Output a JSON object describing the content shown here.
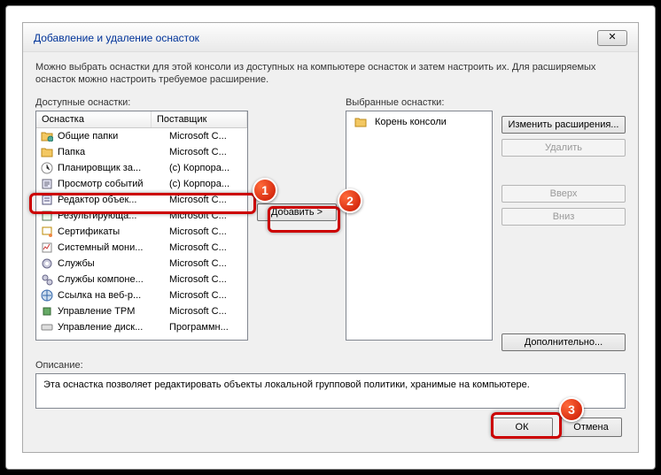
{
  "window": {
    "title": "Добавление и удаление оснасток",
    "close_glyph": "✕"
  },
  "intro": "Можно выбрать оснастки для этой консоли из доступных на компьютере оснасток и затем настроить их. Для расширяемых оснасток можно настроить требуемое расширение.",
  "available": {
    "label": "Доступные оснастки:",
    "col1": "Оснастка",
    "col2": "Поставщик",
    "items": [
      {
        "icon": "folder-share",
        "name": "Общие папки",
        "vendor": "Microsoft C..."
      },
      {
        "icon": "folder",
        "name": "Папка",
        "vendor": "Microsoft C..."
      },
      {
        "icon": "clock",
        "name": "Планировщик за...",
        "vendor": "(c) Корпора..."
      },
      {
        "icon": "event-log",
        "name": "Просмотр событий",
        "vendor": "(c) Корпора..."
      },
      {
        "icon": "gpo-editor",
        "name": "Редактор объек...",
        "vendor": "Microsoft C...",
        "selected": true
      },
      {
        "icon": "policy-result",
        "name": "Результирующа...",
        "vendor": "Microsoft C..."
      },
      {
        "icon": "certificate",
        "name": "Сертификаты",
        "vendor": "Microsoft C..."
      },
      {
        "icon": "perfmon",
        "name": "Системный мони...",
        "vendor": "Microsoft C..."
      },
      {
        "icon": "services",
        "name": "Службы",
        "vendor": "Microsoft C..."
      },
      {
        "icon": "component",
        "name": "Службы компоне...",
        "vendor": "Microsoft C..."
      },
      {
        "icon": "weblink",
        "name": "Ссылка на веб-р...",
        "vendor": "Microsoft C..."
      },
      {
        "icon": "tpm",
        "name": "Управление TPM",
        "vendor": "Microsoft C..."
      },
      {
        "icon": "disk",
        "name": "Управление диск...",
        "vendor": "Программн..."
      }
    ]
  },
  "selected": {
    "label": "Выбранные оснастки:",
    "root": "Корень консоли"
  },
  "buttons": {
    "add": "Добавить >",
    "edit_ext": "Изменить расширения...",
    "remove": "Удалить",
    "up": "Вверх",
    "down": "Вниз",
    "advanced": "Дополнительно...",
    "ok": "ОК",
    "cancel": "Отмена"
  },
  "description": {
    "label": "Описание:",
    "text": "Эта оснастка позволяет редактировать объекты локальной групповой политики, хранимые на компьютере."
  },
  "annotations": {
    "n1": "1",
    "n2": "2",
    "n3": "3"
  }
}
